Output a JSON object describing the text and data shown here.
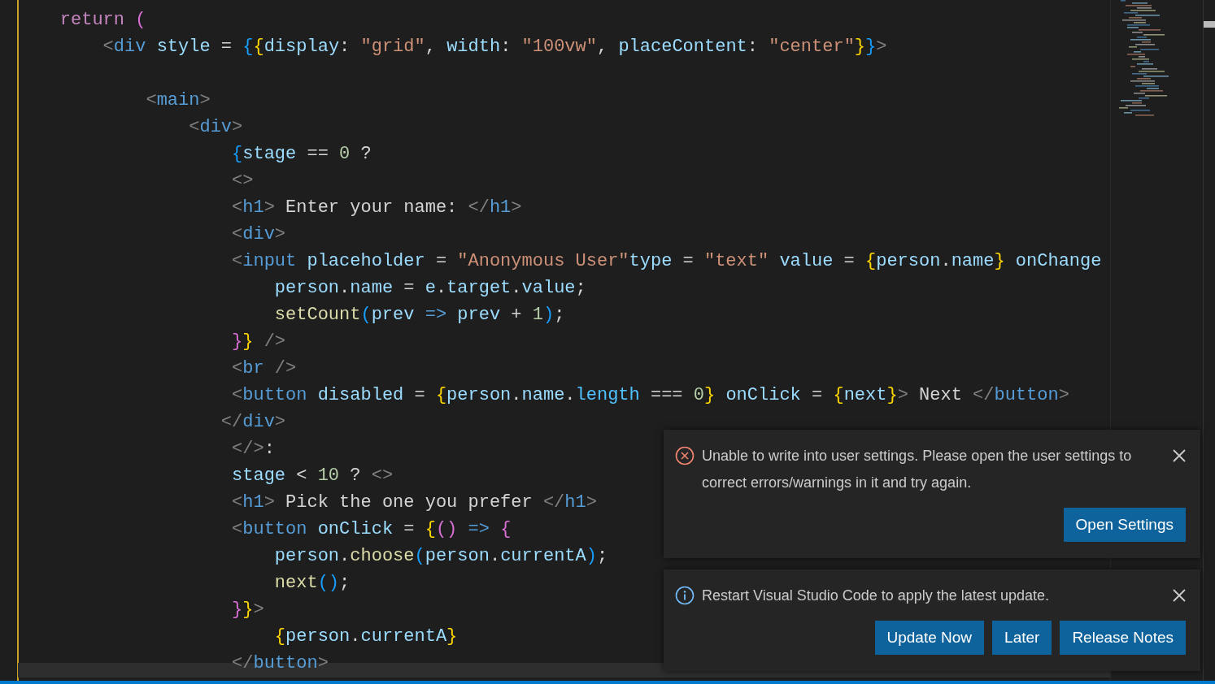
{
  "editor": {
    "lines": [
      {
        "tokens": [
          {
            "kind": "keyword",
            "text": "    return "
          },
          {
            "kind": "brace2",
            "text": "("
          }
        ]
      },
      {
        "tokens": [
          {
            "kind": "punct",
            "text": "        <"
          },
          {
            "kind": "tag",
            "text": "div "
          },
          {
            "kind": "attr",
            "text": "style"
          },
          {
            "kind": "plain",
            "text": " = "
          },
          {
            "kind": "brace3",
            "text": "{"
          },
          {
            "kind": "brace1",
            "text": "{"
          },
          {
            "kind": "attr",
            "text": "display"
          },
          {
            "kind": "plain",
            "text": ": "
          },
          {
            "kind": "string",
            "text": "\"grid\""
          },
          {
            "kind": "plain",
            "text": ", "
          },
          {
            "kind": "attr",
            "text": "width"
          },
          {
            "kind": "plain",
            "text": ": "
          },
          {
            "kind": "string",
            "text": "\"100vw\""
          },
          {
            "kind": "plain",
            "text": ", "
          },
          {
            "kind": "attr",
            "text": "placeContent"
          },
          {
            "kind": "plain",
            "text": ": "
          },
          {
            "kind": "string",
            "text": "\"center\""
          },
          {
            "kind": "brace1",
            "text": "}"
          },
          {
            "kind": "brace3",
            "text": "}"
          },
          {
            "kind": "punct",
            "text": ">"
          }
        ]
      },
      {
        "blank_line_before": true,
        "tokens": [
          {
            "kind": "punct",
            "text": "            <"
          },
          {
            "kind": "tag",
            "text": "main"
          },
          {
            "kind": "punct",
            "text": ">"
          }
        ]
      },
      {
        "tokens": [
          {
            "kind": "punct",
            "text": "                <"
          },
          {
            "kind": "tag",
            "text": "div"
          },
          {
            "kind": "punct",
            "text": ">"
          }
        ]
      },
      {
        "tokens": [
          {
            "kind": "brace3",
            "text": "                    {"
          },
          {
            "kind": "var",
            "text": "stage"
          },
          {
            "kind": "plain",
            "text": " == "
          },
          {
            "kind": "number",
            "text": "0"
          },
          {
            "kind": "plain",
            "text": " ?"
          }
        ]
      },
      {
        "tokens": [
          {
            "kind": "punct",
            "text": "                    <>"
          }
        ]
      },
      {
        "tokens": [
          {
            "kind": "punct",
            "text": "                    <"
          },
          {
            "kind": "tag",
            "text": "h1"
          },
          {
            "kind": "punct",
            "text": ">"
          },
          {
            "kind": "plain",
            "text": " Enter your name: "
          },
          {
            "kind": "punct",
            "text": "</"
          },
          {
            "kind": "tag",
            "text": "h1"
          },
          {
            "kind": "punct",
            "text": ">"
          }
        ]
      },
      {
        "tokens": [
          {
            "kind": "punct",
            "text": "                    <"
          },
          {
            "kind": "tag",
            "text": "div"
          },
          {
            "kind": "punct",
            "text": ">"
          }
        ]
      },
      {
        "tokens": [
          {
            "kind": "punct",
            "text": "                    <"
          },
          {
            "kind": "tag",
            "text": "input "
          },
          {
            "kind": "attr",
            "text": "placeholder"
          },
          {
            "kind": "plain",
            "text": " = "
          },
          {
            "kind": "string",
            "text": "\"Anonymous User\""
          },
          {
            "kind": "attr",
            "text": "type"
          },
          {
            "kind": "plain",
            "text": " = "
          },
          {
            "kind": "string",
            "text": "\"text\" "
          },
          {
            "kind": "attr",
            "text": "value"
          },
          {
            "kind": "plain",
            "text": " = "
          },
          {
            "kind": "brace1",
            "text": "{"
          },
          {
            "kind": "var",
            "text": "person"
          },
          {
            "kind": "plain",
            "text": "."
          },
          {
            "kind": "var",
            "text": "name"
          },
          {
            "kind": "brace1",
            "text": "} "
          },
          {
            "kind": "attr",
            "text": "onChange"
          }
        ]
      },
      {
        "tokens": [
          {
            "kind": "var",
            "text": "                        person"
          },
          {
            "kind": "plain",
            "text": "."
          },
          {
            "kind": "var",
            "text": "name"
          },
          {
            "kind": "plain",
            "text": " = "
          },
          {
            "kind": "var",
            "text": "e"
          },
          {
            "kind": "plain",
            "text": "."
          },
          {
            "kind": "var",
            "text": "target"
          },
          {
            "kind": "plain",
            "text": "."
          },
          {
            "kind": "var",
            "text": "value"
          },
          {
            "kind": "plain",
            "text": ";"
          }
        ]
      },
      {
        "tokens": [
          {
            "kind": "func",
            "text": "                        setCount"
          },
          {
            "kind": "brace3",
            "text": "("
          },
          {
            "kind": "var",
            "text": "prev "
          },
          {
            "kind": "arrow",
            "text": "=> "
          },
          {
            "kind": "var",
            "text": "prev"
          },
          {
            "kind": "plain",
            "text": " + "
          },
          {
            "kind": "number",
            "text": "1"
          },
          {
            "kind": "brace3",
            "text": ")"
          },
          {
            "kind": "plain",
            "text": ";"
          }
        ]
      },
      {
        "tokens": [
          {
            "kind": "brace2",
            "text": "                    }"
          },
          {
            "kind": "brace1",
            "text": "}"
          },
          {
            "kind": "punct",
            "text": " />"
          }
        ]
      },
      {
        "tokens": [
          {
            "kind": "punct",
            "text": "                    <"
          },
          {
            "kind": "tag",
            "text": "br"
          },
          {
            "kind": "punct",
            "text": " />"
          }
        ]
      },
      {
        "tokens": [
          {
            "kind": "punct",
            "text": "                    <"
          },
          {
            "kind": "tag",
            "text": "button "
          },
          {
            "kind": "attr",
            "text": "disabled"
          },
          {
            "kind": "plain",
            "text": " = "
          },
          {
            "kind": "brace1",
            "text": "{"
          },
          {
            "kind": "var",
            "text": "person"
          },
          {
            "kind": "plain",
            "text": "."
          },
          {
            "kind": "var",
            "text": "name"
          },
          {
            "kind": "plain",
            "text": "."
          },
          {
            "kind": "prop",
            "text": "length"
          },
          {
            "kind": "plain",
            "text": " === "
          },
          {
            "kind": "number",
            "text": "0"
          },
          {
            "kind": "brace1",
            "text": "} "
          },
          {
            "kind": "attr",
            "text": "onClick"
          },
          {
            "kind": "plain",
            "text": " = "
          },
          {
            "kind": "brace1",
            "text": "{"
          },
          {
            "kind": "var",
            "text": "next"
          },
          {
            "kind": "brace1",
            "text": "}"
          },
          {
            "kind": "punct",
            "text": ">"
          },
          {
            "kind": "plain",
            "text": " Next "
          },
          {
            "kind": "punct",
            "text": "</"
          },
          {
            "kind": "tag",
            "text": "button"
          },
          {
            "kind": "punct",
            "text": ">"
          }
        ]
      },
      {
        "tokens": [
          {
            "kind": "punct",
            "text": "                   </"
          },
          {
            "kind": "tag",
            "text": "div"
          },
          {
            "kind": "punct",
            "text": ">"
          }
        ]
      },
      {
        "tokens": [
          {
            "kind": "punct",
            "text": "                    </>"
          },
          {
            "kind": "plain",
            "text": ":"
          }
        ]
      },
      {
        "tokens": [
          {
            "kind": "var",
            "text": "                    stage"
          },
          {
            "kind": "plain",
            "text": " < "
          },
          {
            "kind": "number",
            "text": "10"
          },
          {
            "kind": "plain",
            "text": " ? "
          },
          {
            "kind": "punct",
            "text": "<>"
          }
        ]
      },
      {
        "tokens": [
          {
            "kind": "punct",
            "text": "                    <"
          },
          {
            "kind": "tag",
            "text": "h1"
          },
          {
            "kind": "punct",
            "text": ">"
          },
          {
            "kind": "plain",
            "text": " Pick the one you prefer "
          },
          {
            "kind": "punct",
            "text": "</"
          },
          {
            "kind": "tag",
            "text": "h1"
          },
          {
            "kind": "punct",
            "text": ">"
          }
        ]
      },
      {
        "tokens": [
          {
            "kind": "punct",
            "text": "                    <"
          },
          {
            "kind": "tag",
            "text": "button "
          },
          {
            "kind": "attr",
            "text": "onClick"
          },
          {
            "kind": "plain",
            "text": " = "
          },
          {
            "kind": "brace1",
            "text": "{"
          },
          {
            "kind": "brace2",
            "text": "() "
          },
          {
            "kind": "arrow",
            "text": "=> "
          },
          {
            "kind": "brace2",
            "text": "{"
          }
        ]
      },
      {
        "tokens": [
          {
            "kind": "var",
            "text": "                        person"
          },
          {
            "kind": "plain",
            "text": "."
          },
          {
            "kind": "func",
            "text": "choose"
          },
          {
            "kind": "brace3",
            "text": "("
          },
          {
            "kind": "var",
            "text": "person"
          },
          {
            "kind": "plain",
            "text": "."
          },
          {
            "kind": "var",
            "text": "currentA"
          },
          {
            "kind": "brace3",
            "text": ")"
          },
          {
            "kind": "plain",
            "text": ";"
          }
        ]
      },
      {
        "tokens": [
          {
            "kind": "func",
            "text": "                        next"
          },
          {
            "kind": "brace3",
            "text": "()"
          },
          {
            "kind": "plain",
            "text": ";"
          }
        ]
      },
      {
        "tokens": [
          {
            "kind": "brace2",
            "text": "                    }"
          },
          {
            "kind": "brace1",
            "text": "}"
          },
          {
            "kind": "punct",
            "text": ">"
          }
        ]
      },
      {
        "tokens": [
          {
            "kind": "brace1",
            "text": "                        {"
          },
          {
            "kind": "var",
            "text": "person"
          },
          {
            "kind": "plain",
            "text": "."
          },
          {
            "kind": "var",
            "text": "currentA"
          },
          {
            "kind": "brace1",
            "text": "}"
          }
        ]
      },
      {
        "tokens": [
          {
            "kind": "punct",
            "text": "                    </"
          },
          {
            "kind": "tag",
            "text": "button"
          },
          {
            "kind": "punct",
            "text": ">"
          }
        ]
      }
    ]
  },
  "notifications": [
    {
      "kind": "error",
      "message": "Unable to write into user settings. Please open the user settings to correct errors/warnings in it and try again.",
      "buttons": [
        "Open Settings"
      ]
    },
    {
      "kind": "info",
      "message": "Restart Visual Studio Code to apply the latest update.",
      "buttons": [
        "Update Now",
        "Later",
        "Release Notes"
      ]
    }
  ]
}
